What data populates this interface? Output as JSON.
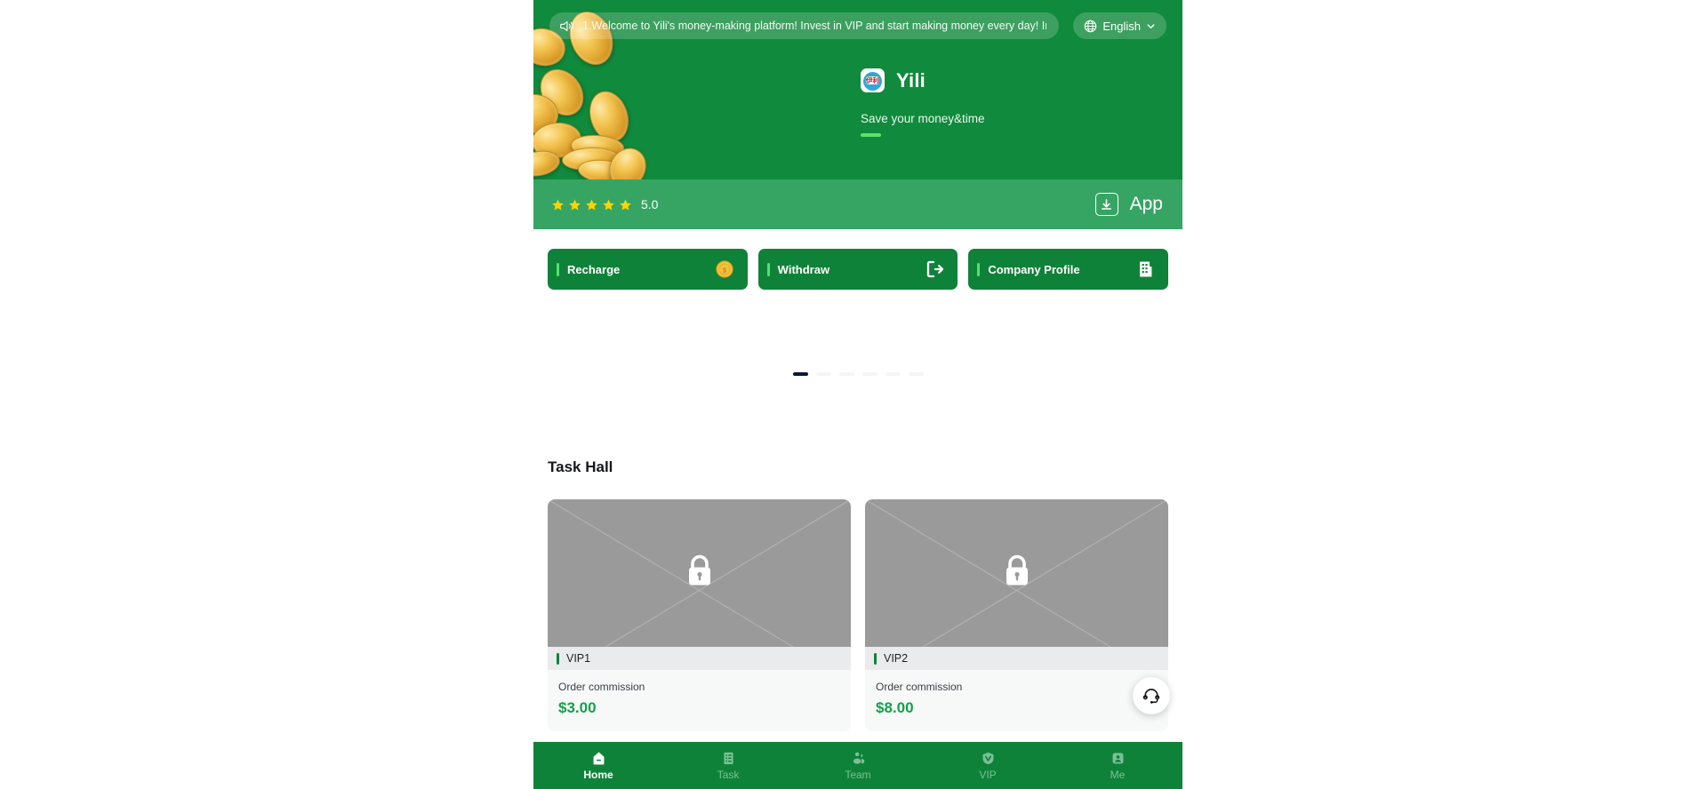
{
  "app": {
    "name": "Yili",
    "tagline": "Save your money&time",
    "logo_icon": "yili-logo-icon"
  },
  "announcement": {
    "speaker_icon": "speaker-icon",
    "text": "1.Welcome to Yili's money-making platform! Invest in VIP and start making money every day! Invite",
    "language": {
      "globe_icon": "globe-icon",
      "label": "English",
      "chevron_icon": "chevron-down-icon"
    }
  },
  "rating": {
    "stars": 5,
    "score": "5.0",
    "download": {
      "icon": "download-icon",
      "label": "App"
    }
  },
  "actions": [
    {
      "label": "Recharge",
      "icon": "coin-icon"
    },
    {
      "label": "Withdraw",
      "icon": "exit-arrow-icon"
    },
    {
      "label": "Company Profile",
      "icon": "building-icon"
    }
  ],
  "carousel": {
    "total": 6,
    "active_index": 0
  },
  "task_hall": {
    "title": "Task Hall",
    "cards": [
      {
        "level": "VIP1",
        "commission_label": "Order commission",
        "amount": "$3.00",
        "image_icon": "locked-image-icon"
      },
      {
        "level": "VIP2",
        "commission_label": "Order commission",
        "amount": "$8.00",
        "image_icon": "locked-image-icon"
      }
    ]
  },
  "support": {
    "icon": "headset-icon"
  },
  "bottom_nav": {
    "active": "Home",
    "items": [
      {
        "label": "Home",
        "icon": "home-icon"
      },
      {
        "label": "Task",
        "icon": "list-icon"
      },
      {
        "label": "Team",
        "icon": "people-icon"
      },
      {
        "label": "VIP",
        "icon": "shield-icon"
      },
      {
        "label": "Me",
        "icon": "profile-icon"
      }
    ]
  },
  "colors": {
    "brand_green": "#108a3c",
    "light_green": "#36a564",
    "accent_green": "#56e06a",
    "amount_green": "#13a14a",
    "star_yellow": "#ffd400"
  }
}
